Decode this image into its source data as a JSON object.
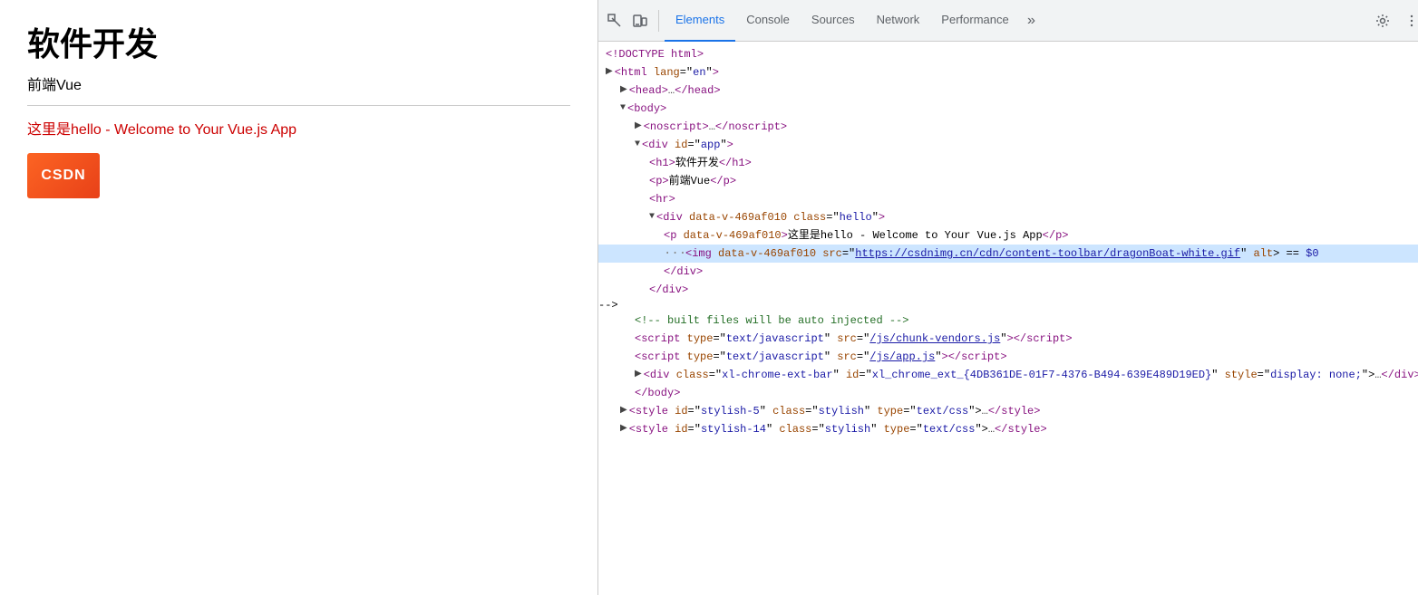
{
  "leftPanel": {
    "title": "软件开发",
    "subtitle": "前端Vue",
    "link": "这里是hello - Welcome to Your Vue.js App",
    "logoText": "CSDN"
  },
  "devtools": {
    "tabs": [
      {
        "label": "Elements",
        "active": true
      },
      {
        "label": "Console",
        "active": false
      },
      {
        "label": "Sources",
        "active": false
      },
      {
        "label": "Network",
        "active": false
      },
      {
        "label": "Performance",
        "active": false
      }
    ],
    "moreLabel": "»",
    "htmlLines": [
      {
        "indent": 0,
        "content": "doctype",
        "selected": false
      },
      {
        "indent": 0,
        "content": "html_open",
        "selected": false
      },
      {
        "indent": 1,
        "content": "head_collapsed",
        "selected": false
      },
      {
        "indent": 1,
        "content": "body_open",
        "selected": false
      },
      {
        "indent": 2,
        "content": "noscript_collapsed",
        "selected": false
      },
      {
        "indent": 2,
        "content": "div_app_open",
        "selected": false
      },
      {
        "indent": 3,
        "content": "h1_content",
        "selected": false
      },
      {
        "indent": 3,
        "content": "p_content",
        "selected": false
      },
      {
        "indent": 3,
        "content": "hr",
        "selected": false
      },
      {
        "indent": 3,
        "content": "div_hello_open",
        "selected": false
      },
      {
        "indent": 4,
        "content": "p_hello",
        "selected": false
      },
      {
        "indent": 4,
        "content": "img_line",
        "selected": true
      },
      {
        "indent": 4,
        "content": "div_close",
        "selected": false
      },
      {
        "indent": 3,
        "content": "div_close2",
        "selected": false
      },
      {
        "indent": 2,
        "content": "comment_built",
        "selected": false
      },
      {
        "indent": 2,
        "content": "script_vendors",
        "selected": false
      },
      {
        "indent": 2,
        "content": "script_app",
        "selected": false
      },
      {
        "indent": 2,
        "content": "div_chrome_ext",
        "selected": false
      },
      {
        "indent": 2,
        "content": "body_close",
        "selected": false
      },
      {
        "indent": 1,
        "content": "style_stylish5",
        "selected": false
      },
      {
        "indent": 1,
        "content": "style_stylish14",
        "selected": false
      }
    ]
  }
}
